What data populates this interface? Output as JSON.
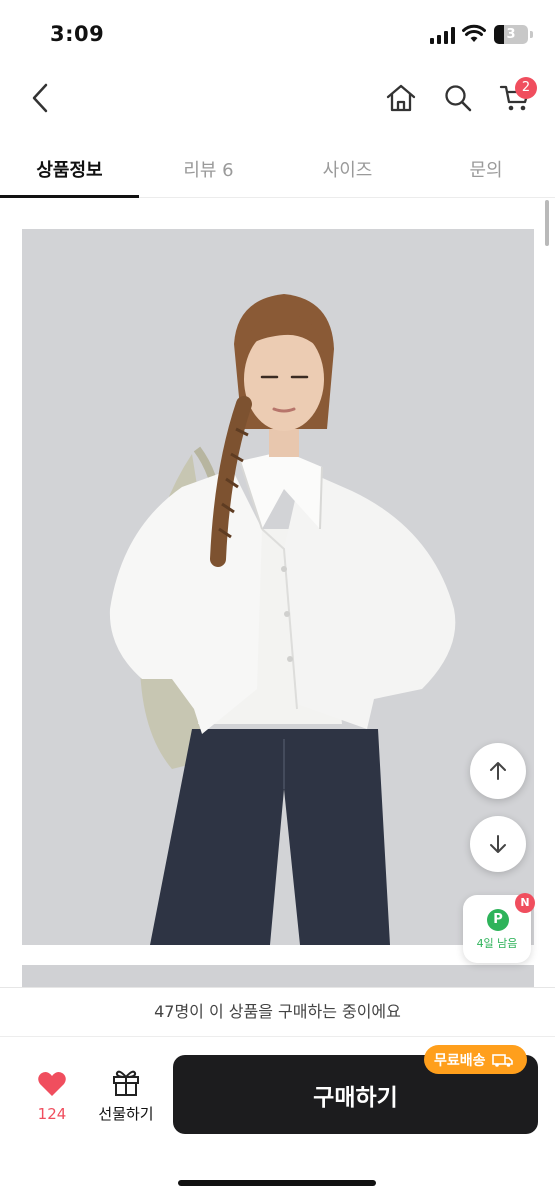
{
  "status_bar": {
    "time": "3:09",
    "battery": "3"
  },
  "header": {
    "cart_count": "2"
  },
  "tabs": [
    {
      "label": "상품정보"
    },
    {
      "label": "리뷰 6"
    },
    {
      "label": "사이즈"
    },
    {
      "label": "문의"
    }
  ],
  "points": {
    "badge": "N",
    "icon": "P",
    "text": "4일 남음"
  },
  "viewers_text": "47명이 이 상품을 구매하는 중이에요",
  "actions": {
    "like_count": "124",
    "gift_label": "선물하기",
    "buy_label": "구매하기",
    "free_shipping": "무료배송"
  },
  "colors": {
    "accent": "#f04e5e",
    "buy_button": "#1c1c1e",
    "free_ship": "#ff9f1c",
    "points": "#2eb35a"
  }
}
